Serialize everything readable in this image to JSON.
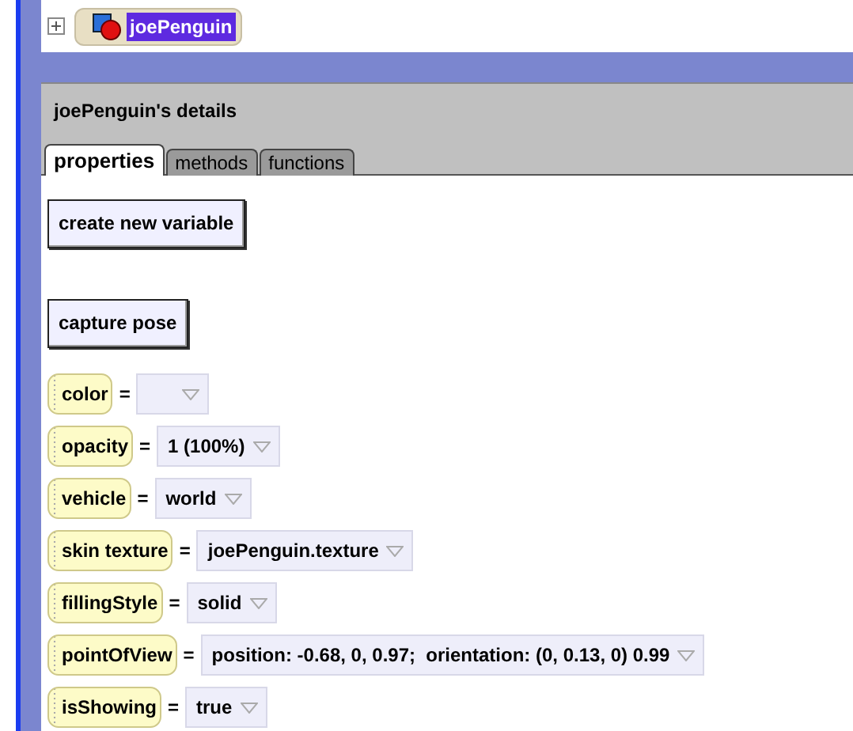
{
  "tree": {
    "expanded": false,
    "label": "joePenguin",
    "selected": true
  },
  "details": {
    "title": "joePenguin's details",
    "tabs": [
      {
        "label": "properties",
        "selected": true
      },
      {
        "label": "methods",
        "selected": false
      },
      {
        "label": "functions",
        "selected": false
      }
    ],
    "buttons": [
      "create new variable",
      "capture pose"
    ],
    "properties": [
      {
        "name": "color",
        "equals": "="
      },
      {
        "name": "opacity",
        "equals": "=",
        "value": "1 (100%)"
      },
      {
        "name": "vehicle",
        "equals": "=",
        "value": "world"
      },
      {
        "name": "skin texture",
        "equals": "=",
        "value": "joePenguin.texture"
      },
      {
        "name": "fillingStyle",
        "equals": "=",
        "value": "solid"
      },
      {
        "name": "pointOfView",
        "equals": "=",
        "value": "position: -0.68, 0, 0.97;  orientation: (0, 0.13, 0) 0.99"
      },
      {
        "name": "isShowing",
        "equals": "=",
        "value": "true"
      }
    ]
  }
}
